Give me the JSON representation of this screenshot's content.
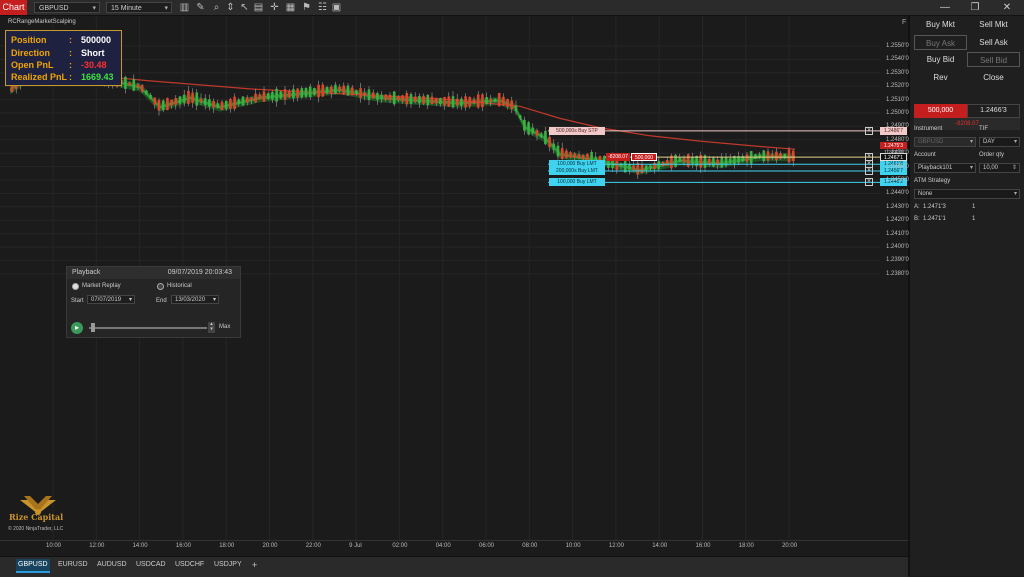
{
  "toolbar": {
    "chart_tab": "Chart",
    "instrument": "GBPUSD",
    "interval": "15 Minute",
    "f_label": "F"
  },
  "indicator_name": "RCRangeMarketScalping",
  "position_box": {
    "rows": [
      {
        "label": "Position",
        "value": "500000",
        "color": "#ffffff"
      },
      {
        "label": "Direction",
        "value": "Short",
        "color": "#ffffff"
      },
      {
        "label": "Open PnL",
        "value": "-30.48",
        "color": "#ff3030"
      },
      {
        "label": "Realized PnL",
        "value": "1669.43",
        "color": "#40e040"
      }
    ]
  },
  "price_axis": [
    "1.2550'0",
    "1.2540'0",
    "1.2530'0",
    "1.2520'0",
    "1.2510'0",
    "1.2500'0",
    "1.2490'0",
    "1.2480'0",
    "1.2470'0",
    "1.2460'0",
    "1.2450'0",
    "1.2440'0",
    "1.2430'0",
    "1.2420'0",
    "1.2410'0",
    "1.2400'0",
    "1.2390'0",
    "1.2380'0"
  ],
  "time_axis": [
    "10:00",
    "12:00",
    "14:00",
    "16:00",
    "18:00",
    "20:00",
    "22:00",
    "9 Jul",
    "02:00",
    "04:00",
    "06:00",
    "08:00",
    "10:00",
    "12:00",
    "14:00",
    "16:00",
    "18:00",
    "20:00"
  ],
  "orders": [
    {
      "label": "500,000s  Buy STP",
      "price": "1.2486'7",
      "price_value": 1.24867,
      "color": "#f2c9c9",
      "text": "#552222"
    },
    {
      "label": "100,000  Buy LMT",
      "price": "1.2461'8",
      "price_value": 1.24618,
      "color": "#3fd3f0",
      "text": "#08303a"
    },
    {
      "label": "200,000s  Buy LMT",
      "price": "1.2456'7",
      "price_value": 1.24567,
      "color": "#3fd3f0",
      "text": "#08303a"
    },
    {
      "label": "100,000  Buy LMT",
      "price": "1.2448'2",
      "price_value": 1.24482,
      "color": "#3fd3f0",
      "text": "#08303a"
    }
  ],
  "position_line": {
    "pnl": "-8208.07",
    "qty": "500,000",
    "price_value": 1.24671
  },
  "price_tags": [
    {
      "text": "1.2475'3",
      "bg": "#c41e1e",
      "fg": "#ffffff",
      "price_value": 1.24753
    },
    {
      "text": "1.2470'0",
      "bg": "#1b1b1b",
      "fg": "#bbbbbb",
      "price_value": 1.247
    },
    {
      "text": "1.2467'1",
      "bg": "#111111",
      "fg": "#ffffff",
      "price_value": 1.24671
    }
  ],
  "copyright": "© 2020 NinjaTrader, LLC",
  "logo_text": "Rize Capital",
  "playback": {
    "title": "Playback",
    "datetime": "09/07/2019 20:03:43",
    "market_replay": "Market Replay",
    "historical": "Historical",
    "start_label": "Start",
    "start_date": "07/07/2019",
    "end_label": "End",
    "end_date": "13/03/2020",
    "max_label": "Max",
    "speed": 0.02
  },
  "panel": {
    "buy_mkt": "Buy Mkt",
    "sell_mkt": "Sell Mkt",
    "buy_ask": "Buy Ask",
    "sell_ask": "Sell Ask",
    "buy_bid": "Buy Bid",
    "sell_bid": "Sell Bid",
    "rev": "Rev",
    "close": "Close",
    "pos_qty": "500,000",
    "pos_price": "1.2466'3",
    "pos_pnl": "-8208.07",
    "instrument_label": "Instrument",
    "instrument_value": "GBPUSD",
    "tif_label": "TIF",
    "tif_value": "DAY",
    "account_label": "Account",
    "account_value": "Playback101",
    "orderqty_label": "Order qty",
    "orderqty_value": "10,00",
    "atm_label": "ATM Strategy",
    "atm_value": "None",
    "ask_label": "A:",
    "ask_value": "1.2471'3",
    "ask_size": "1",
    "bid_label": "B:",
    "bid_value": "1.2471'1",
    "bid_size": "1"
  },
  "bottom_tabs": [
    "GBPUSD",
    "EURUSD",
    "AUDUSD",
    "USDCAD",
    "USDCHF",
    "USDJPY",
    "+"
  ],
  "colors": {
    "accent": "#c41e1e",
    "ema": "#c0392b",
    "ribbon": "#1f7a2a",
    "up": "#3cb043",
    "down": "#e0442b"
  }
}
